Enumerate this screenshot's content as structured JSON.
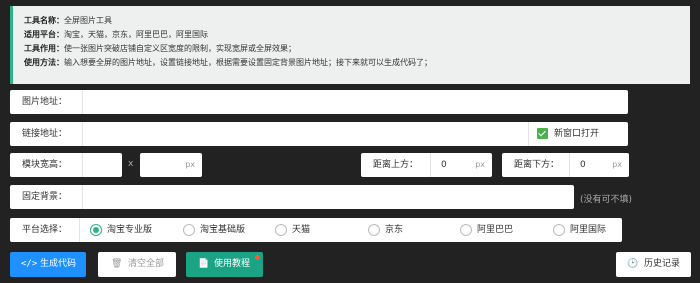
{
  "info": {
    "lines": [
      {
        "key": "工具名称：",
        "value": "全屏图片工具"
      },
      {
        "key": "适用平台：",
        "value": "淘宝，天猫，京东，阿里巴巴，阿里国际"
      },
      {
        "key": "工具作用：",
        "value": "使一张图片突破店铺自定义区宽度的限制，实现宽屏或全屏效果；"
      },
      {
        "key": "使用方法：",
        "value": "输入想要全屏的图片地址，设置链接地址，根据需要设置固定背景图片地址；接下来就可以生成代码了；"
      }
    ]
  },
  "form": {
    "image_url": {
      "label": "图片地址：",
      "value": ""
    },
    "link_url": {
      "label": "链接地址：",
      "value": "",
      "new_window_label": "新窗口打开",
      "new_window_checked": true
    },
    "width": {
      "label": "模块宽高：",
      "value1": "",
      "separator": "x",
      "value2": "",
      "unit": "px"
    },
    "top": {
      "label": "距离上方：",
      "value": "0",
      "unit": "px"
    },
    "bottom": {
      "label": "距离下方：",
      "value": "0",
      "unit": "px"
    },
    "bg": {
      "label": "固定背景：",
      "value": "",
      "hint": "(没有可不填)"
    },
    "platform": {
      "label": "平台选择：",
      "selected": "淘宝专业版",
      "options": [
        "淘宝专业版",
        "淘宝基础版",
        "天猫",
        "京东",
        "阿里巴巴",
        "阿里国际"
      ]
    }
  },
  "buttons": {
    "generate": "生成代码",
    "clear": "清空全部",
    "tutorial": "使用教程",
    "history": "历史记录"
  },
  "colors": {
    "accent": "#2db28a",
    "primary": "#1e90ff",
    "check": "#4caf50",
    "badge": "#ff5a36",
    "background": "#222222"
  }
}
